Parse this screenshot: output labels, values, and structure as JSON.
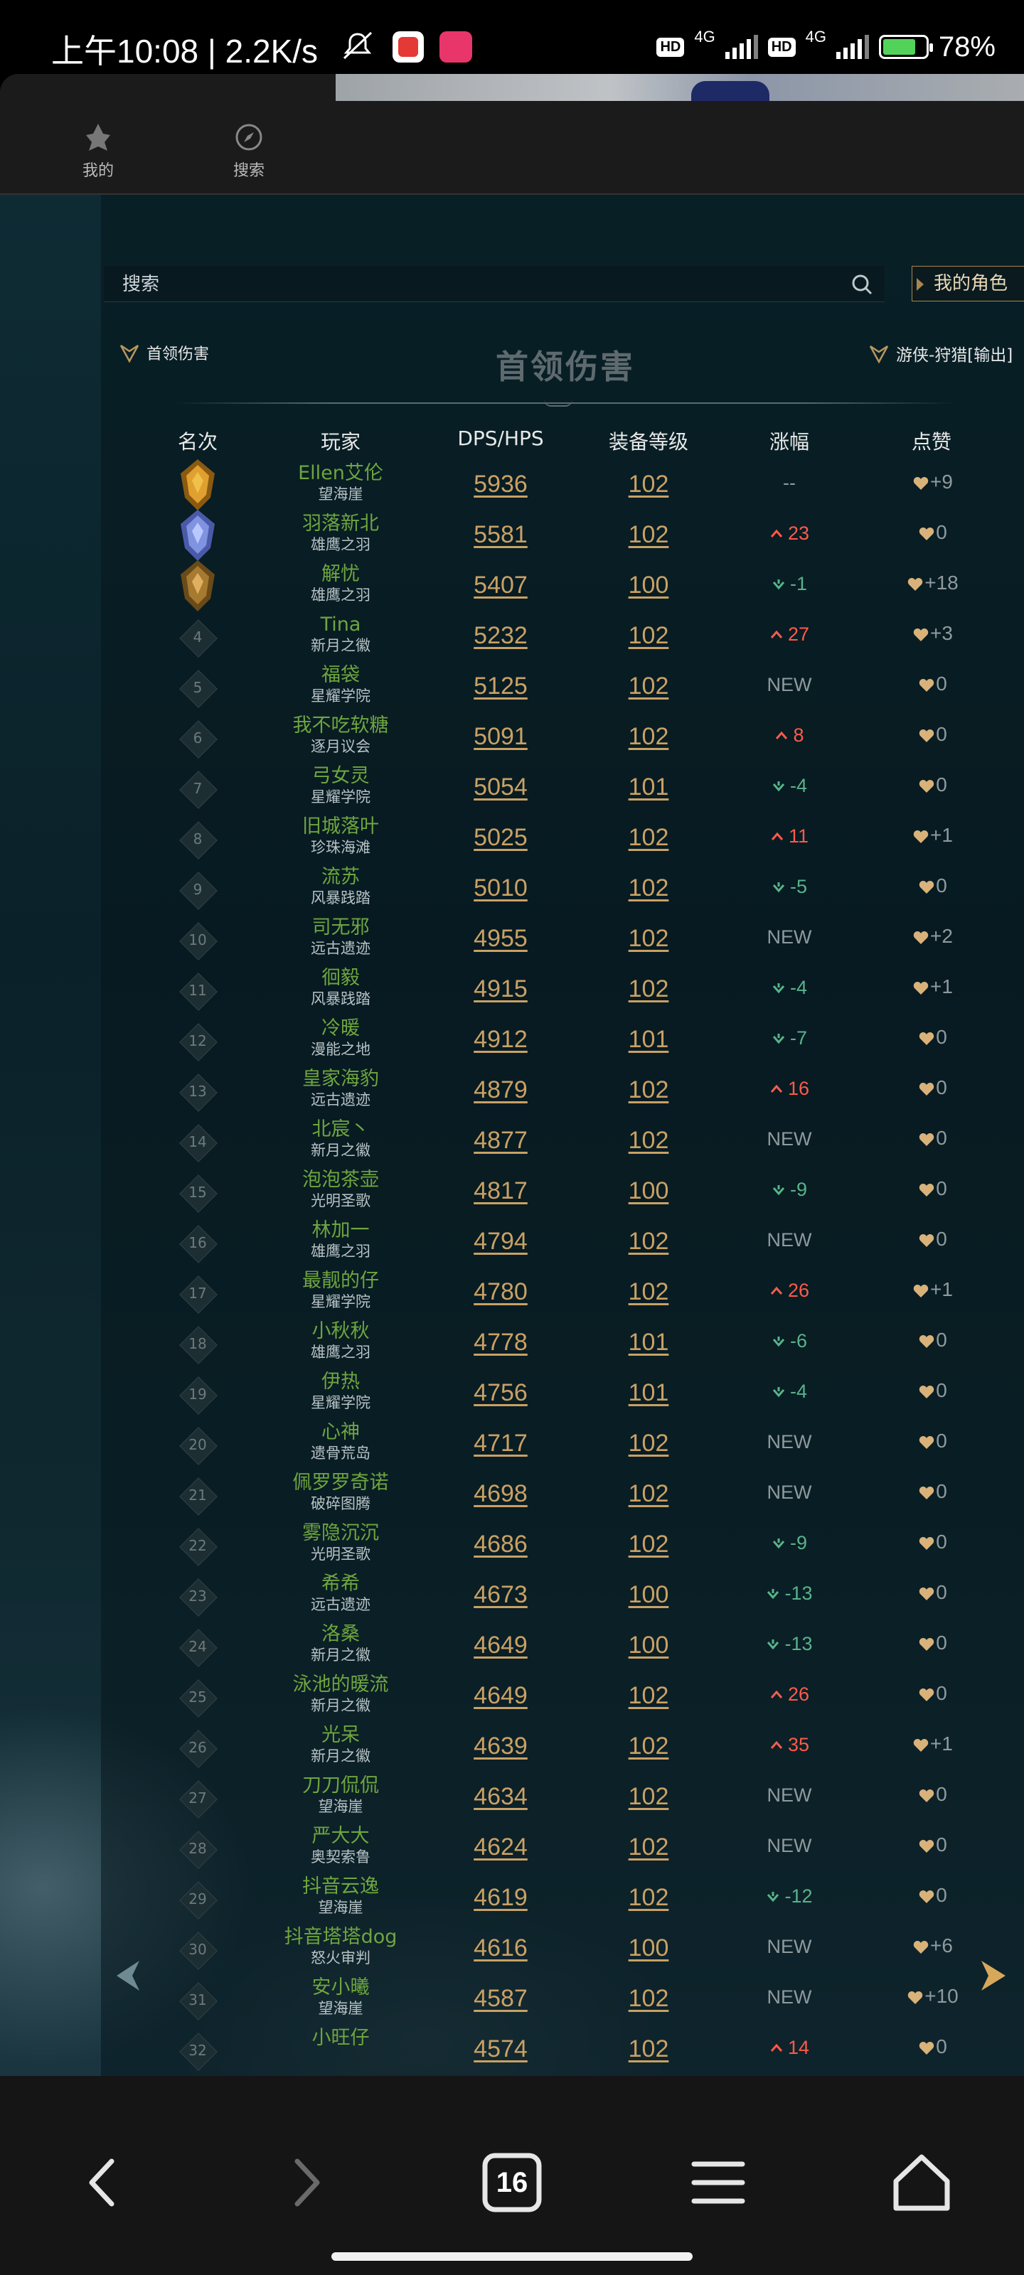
{
  "status_bar": {
    "time": "上午10:08 | 2.2K/s",
    "network_1": "4G",
    "network_2": "4G",
    "hd_1": "HD",
    "hd_2": "HD",
    "battery": "78%",
    "battery_level": 0.78
  },
  "header": {
    "nav_mine": "我的",
    "nav_search": "搜索"
  },
  "search": {
    "placeholder": "搜索"
  },
  "my_role_button": "我的角色",
  "boss_label": "首领伤害",
  "page_title": "首领伤害",
  "role_filter": "游侠-狩猎[输出]",
  "columns": [
    "名次",
    "玩家",
    "DPS/HPS",
    "装备等级",
    "涨幅",
    "点赞"
  ],
  "rows": [
    {
      "rank": "1",
      "name": "Ellen艾伦",
      "realm": "望海崖",
      "dps": "5936",
      "ilvl": "102",
      "change": "--",
      "change_dir": "flat",
      "likes": "+9"
    },
    {
      "rank": "2",
      "name": "羽落新北",
      "realm": "雄鹰之羽",
      "dps": "5581",
      "ilvl": "102",
      "change": "23",
      "change_dir": "up",
      "likes": "0"
    },
    {
      "rank": "3",
      "name": "解忧",
      "realm": "雄鹰之羽",
      "dps": "5407",
      "ilvl": "100",
      "change": "-1",
      "change_dir": "down",
      "likes": "+18"
    },
    {
      "rank": "4",
      "name": "Tina",
      "realm": "新月之徽",
      "dps": "5232",
      "ilvl": "102",
      "change": "27",
      "change_dir": "up",
      "likes": "+3"
    },
    {
      "rank": "5",
      "name": "福袋",
      "realm": "星耀学院",
      "dps": "5125",
      "ilvl": "102",
      "change": "NEW",
      "change_dir": "new",
      "likes": "0"
    },
    {
      "rank": "6",
      "name": "我不吃软糖",
      "realm": "逐月议会",
      "dps": "5091",
      "ilvl": "102",
      "change": "8",
      "change_dir": "up",
      "likes": "0"
    },
    {
      "rank": "7",
      "name": "弓女灵",
      "realm": "星耀学院",
      "dps": "5054",
      "ilvl": "101",
      "change": "-4",
      "change_dir": "down",
      "likes": "0"
    },
    {
      "rank": "8",
      "name": "旧城落叶",
      "realm": "珍珠海滩",
      "dps": "5025",
      "ilvl": "102",
      "change": "11",
      "change_dir": "up",
      "likes": "+1"
    },
    {
      "rank": "9",
      "name": "流苏",
      "realm": "风暴践踏",
      "dps": "5010",
      "ilvl": "102",
      "change": "-5",
      "change_dir": "down",
      "likes": "0"
    },
    {
      "rank": "10",
      "name": "司无邪",
      "realm": "远古遗迹",
      "dps": "4955",
      "ilvl": "102",
      "change": "NEW",
      "change_dir": "new",
      "likes": "+2"
    },
    {
      "rank": "11",
      "name": "徊毅",
      "realm": "风暴践踏",
      "dps": "4915",
      "ilvl": "102",
      "change": "-4",
      "change_dir": "down",
      "likes": "+1"
    },
    {
      "rank": "12",
      "name": "冷暖",
      "realm": "漫能之地",
      "dps": "4912",
      "ilvl": "101",
      "change": "-7",
      "change_dir": "down",
      "likes": "0"
    },
    {
      "rank": "13",
      "name": "皇家海豹",
      "realm": "远古遗迹",
      "dps": "4879",
      "ilvl": "102",
      "change": "16",
      "change_dir": "up",
      "likes": "0"
    },
    {
      "rank": "14",
      "name": "北宸丶",
      "realm": "新月之徽",
      "dps": "4877",
      "ilvl": "102",
      "change": "NEW",
      "change_dir": "new",
      "likes": "0"
    },
    {
      "rank": "15",
      "name": "泡泡茶壶",
      "realm": "光明圣歌",
      "dps": "4817",
      "ilvl": "100",
      "change": "-9",
      "change_dir": "down",
      "likes": "0"
    },
    {
      "rank": "16",
      "name": "林加一",
      "realm": "雄鹰之羽",
      "dps": "4794",
      "ilvl": "102",
      "change": "NEW",
      "change_dir": "new",
      "likes": "0"
    },
    {
      "rank": "17",
      "name": "最靓的仔",
      "realm": "星耀学院",
      "dps": "4780",
      "ilvl": "102",
      "change": "26",
      "change_dir": "up",
      "likes": "+1"
    },
    {
      "rank": "18",
      "name": "小秋秋",
      "realm": "雄鹰之羽",
      "dps": "4778",
      "ilvl": "101",
      "change": "-6",
      "change_dir": "down",
      "likes": "0"
    },
    {
      "rank": "19",
      "name": "伊热",
      "realm": "星耀学院",
      "dps": "4756",
      "ilvl": "101",
      "change": "-4",
      "change_dir": "down",
      "likes": "0"
    },
    {
      "rank": "20",
      "name": "心神",
      "realm": "遗骨荒岛",
      "dps": "4717",
      "ilvl": "102",
      "change": "NEW",
      "change_dir": "new",
      "likes": "0"
    },
    {
      "rank": "21",
      "name": "佩罗罗奇诺",
      "realm": "破碎图腾",
      "dps": "4698",
      "ilvl": "102",
      "change": "NEW",
      "change_dir": "new",
      "likes": "0"
    },
    {
      "rank": "22",
      "name": "雾隐沉沉",
      "realm": "光明圣歌",
      "dps": "4686",
      "ilvl": "102",
      "change": "-9",
      "change_dir": "down",
      "likes": "0"
    },
    {
      "rank": "23",
      "name": "希希",
      "realm": "远古遗迹",
      "dps": "4673",
      "ilvl": "100",
      "change": "-13",
      "change_dir": "down",
      "likes": "0"
    },
    {
      "rank": "24",
      "name": "洛桑",
      "realm": "新月之徽",
      "dps": "4649",
      "ilvl": "100",
      "change": "-13",
      "change_dir": "down",
      "likes": "0"
    },
    {
      "rank": "25",
      "name": "泳池的暖流",
      "realm": "新月之徽",
      "dps": "4649",
      "ilvl": "102",
      "change": "26",
      "change_dir": "up",
      "likes": "0"
    },
    {
      "rank": "26",
      "name": "光呆",
      "realm": "新月之徽",
      "dps": "4639",
      "ilvl": "102",
      "change": "35",
      "change_dir": "up",
      "likes": "+1"
    },
    {
      "rank": "27",
      "name": "刀刀侃侃",
      "realm": "望海崖",
      "dps": "4634",
      "ilvl": "102",
      "change": "NEW",
      "change_dir": "new",
      "likes": "0"
    },
    {
      "rank": "28",
      "name": "严大大",
      "realm": "奥契索鲁",
      "dps": "4624",
      "ilvl": "102",
      "change": "NEW",
      "change_dir": "new",
      "likes": "0"
    },
    {
      "rank": "29",
      "name": "抖音云逸",
      "realm": "望海崖",
      "dps": "4619",
      "ilvl": "102",
      "change": "-12",
      "change_dir": "down",
      "likes": "0"
    },
    {
      "rank": "30",
      "name": "抖音塔塔dog",
      "realm": "怒火审判",
      "dps": "4616",
      "ilvl": "100",
      "change": "NEW",
      "change_dir": "new",
      "likes": "+6"
    },
    {
      "rank": "31",
      "name": "安小曦",
      "realm": "望海崖",
      "dps": "4587",
      "ilvl": "102",
      "change": "NEW",
      "change_dir": "new",
      "likes": "+10"
    },
    {
      "rank": "32",
      "name": "小旺仔",
      "realm": "",
      "dps": "4574",
      "ilvl": "102",
      "change": "14",
      "change_dir": "up",
      "likes": "0"
    }
  ],
  "bottom_nav": {
    "tabs_count": "16"
  },
  "colors": {
    "player_name": "#6ea53f",
    "gold": "#c9a165",
    "up": "#ff5a4a",
    "down": "#58b38a"
  }
}
